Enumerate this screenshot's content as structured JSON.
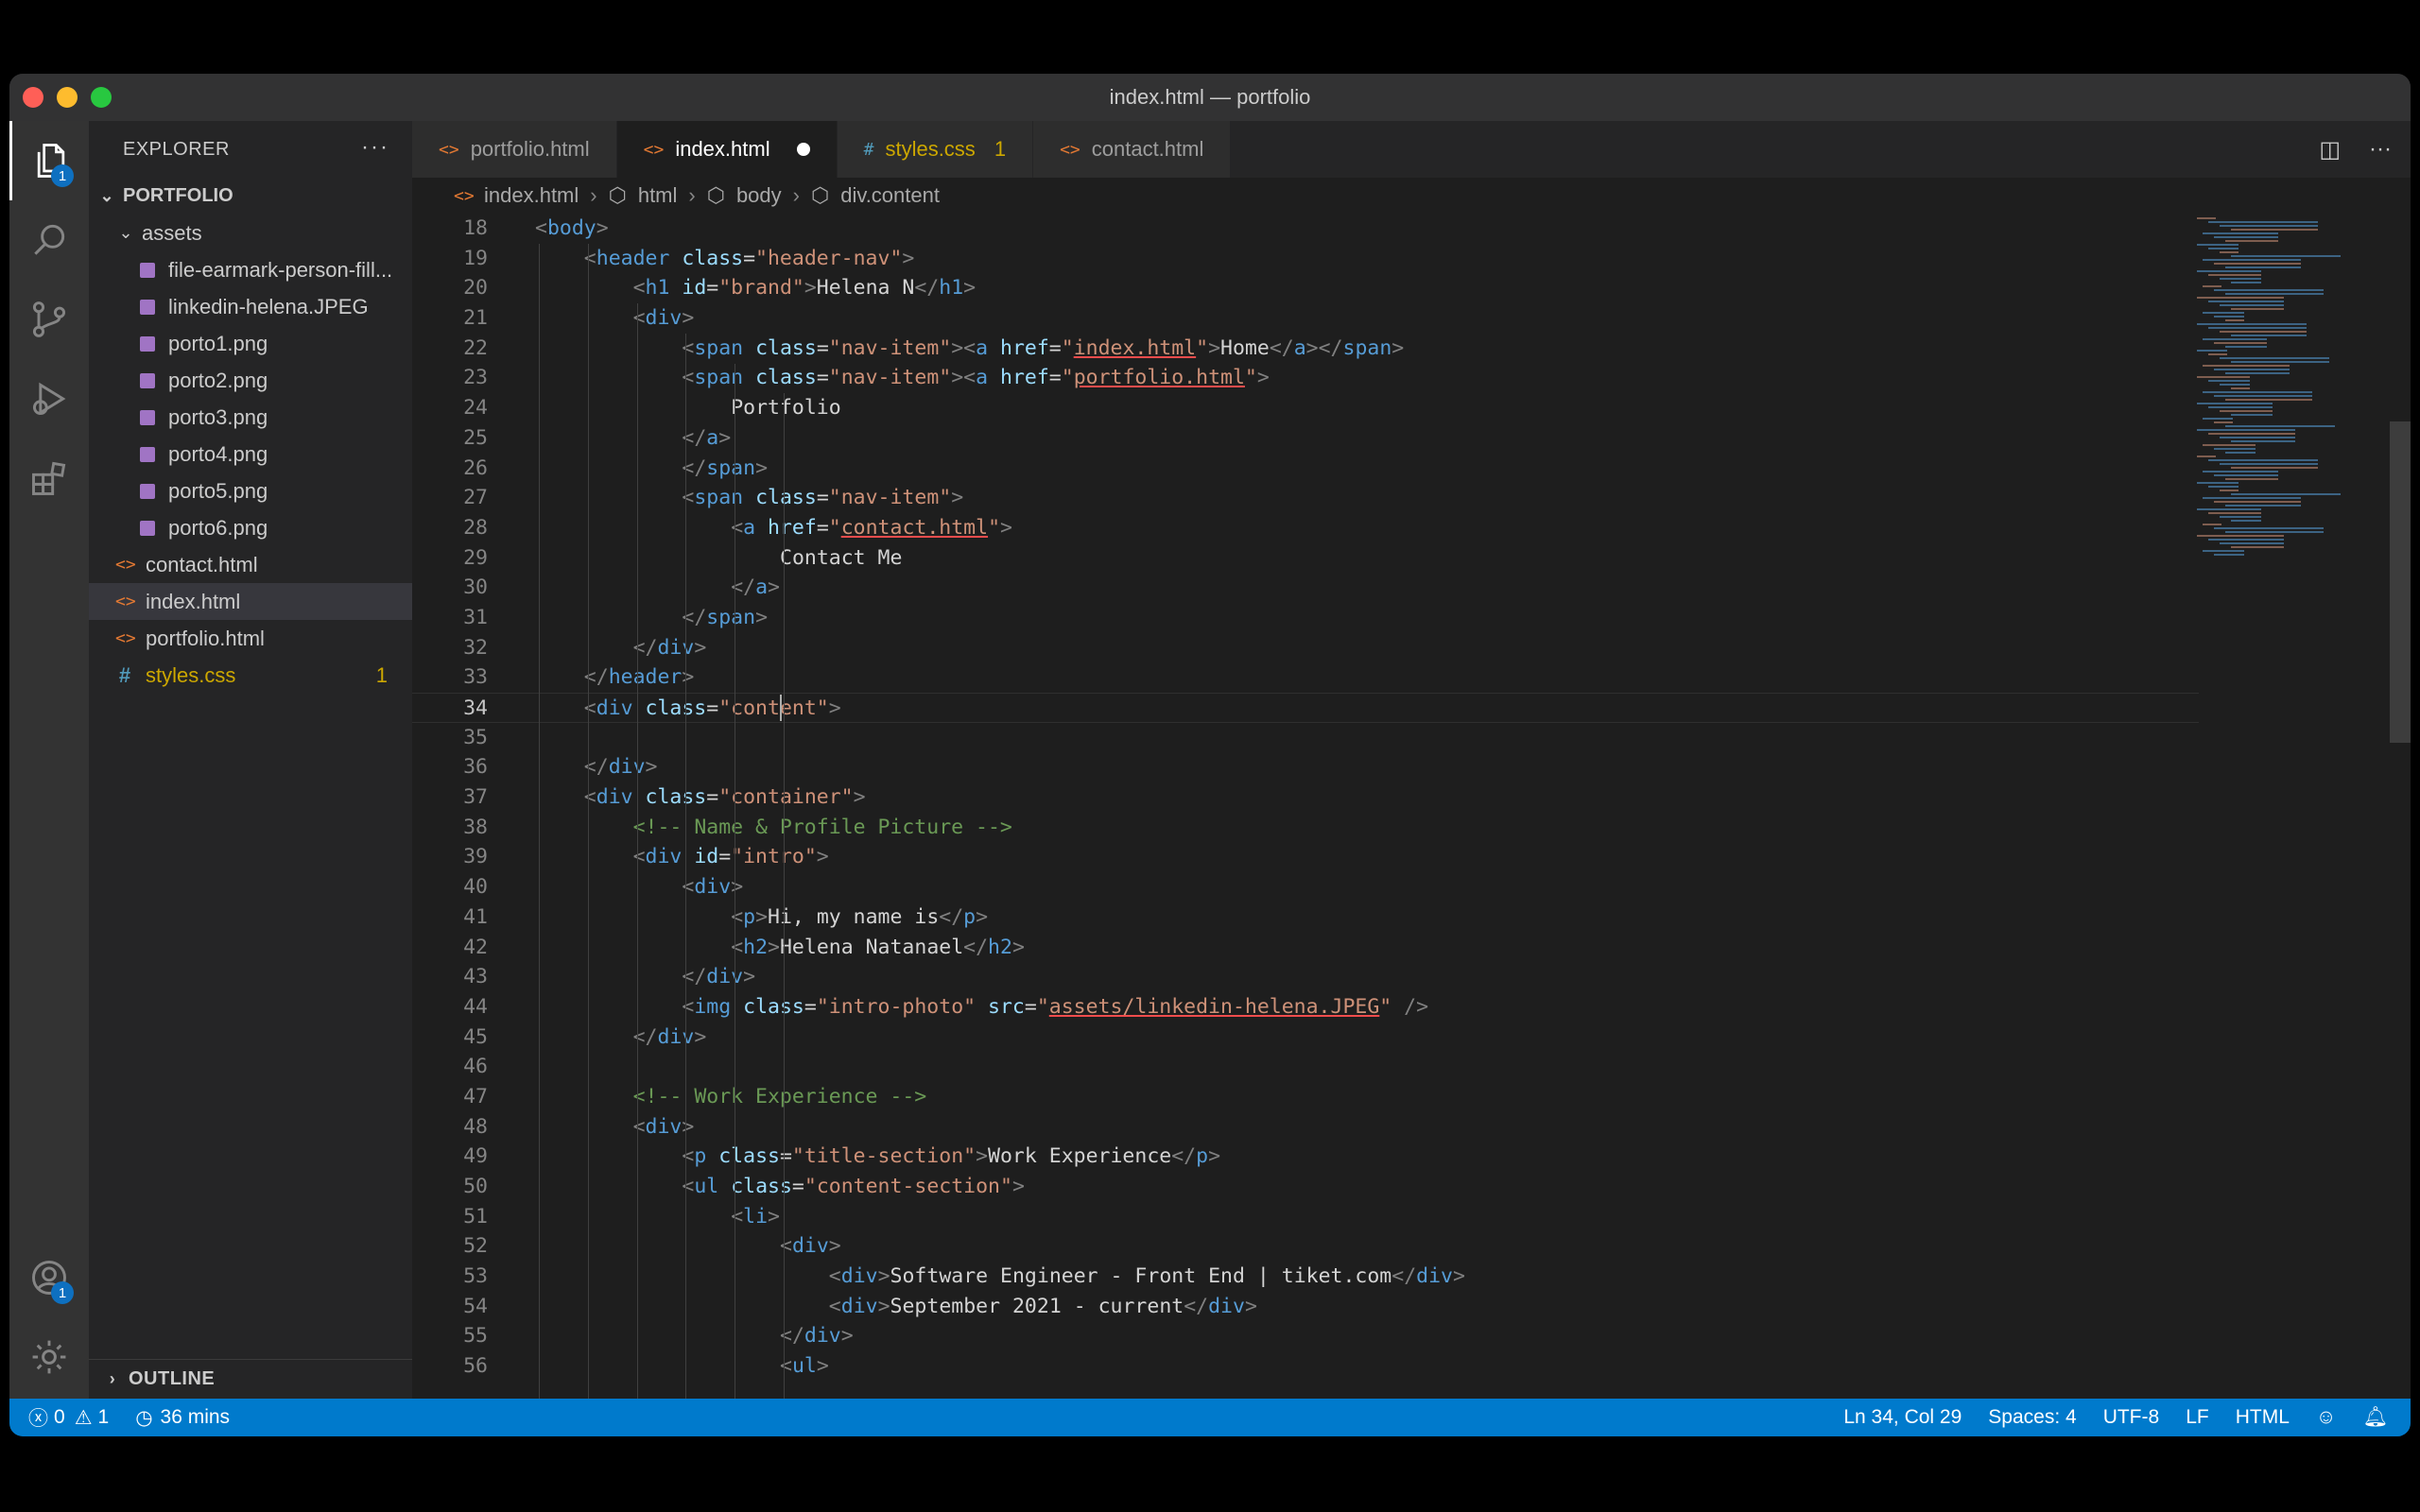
{
  "window": {
    "title": "index.html — portfolio"
  },
  "activity_bar": {
    "items": [
      {
        "name": "explorer",
        "icon": "files-icon",
        "badge": "1"
      },
      {
        "name": "search",
        "icon": "search-icon"
      },
      {
        "name": "source-control",
        "icon": "source-control-icon"
      },
      {
        "name": "run-debug",
        "icon": "run-debug-icon"
      },
      {
        "name": "extensions",
        "icon": "extensions-icon"
      }
    ],
    "accounts_badge": "1"
  },
  "sidebar": {
    "title": "EXPLORER",
    "more": "···",
    "folder": "PORTFOLIO",
    "items": [
      {
        "label": "assets",
        "type": "folder"
      },
      {
        "label": "file-earmark-person-fill...",
        "type": "file-svg"
      },
      {
        "label": "linkedin-helena.JPEG",
        "type": "image"
      },
      {
        "label": "porto1.png",
        "type": "image"
      },
      {
        "label": "porto2.png",
        "type": "image"
      },
      {
        "label": "porto3.png",
        "type": "image"
      },
      {
        "label": "porto4.png",
        "type": "image"
      },
      {
        "label": "porto5.png",
        "type": "image"
      },
      {
        "label": "porto6.png",
        "type": "image"
      },
      {
        "label": "contact.html",
        "type": "html"
      },
      {
        "label": "index.html",
        "type": "html",
        "selected": true
      },
      {
        "label": "portfolio.html",
        "type": "html"
      },
      {
        "label": "styles.css",
        "type": "css",
        "problems": "1"
      }
    ],
    "outline": "OUTLINE"
  },
  "tabs": [
    {
      "label": "portfolio.html",
      "type": "html"
    },
    {
      "label": "index.html",
      "type": "html",
      "active": true,
      "dirty": true
    },
    {
      "label": "styles.css",
      "type": "css",
      "problems": "1"
    },
    {
      "label": "contact.html",
      "type": "html"
    }
  ],
  "breadcrumb": [
    "index.html",
    "html",
    "body",
    "div.content"
  ],
  "editor": {
    "lines": [
      {
        "n": "18",
        "indent": 1,
        "t": [
          [
            "br",
            "<"
          ],
          [
            "tg",
            "body"
          ],
          [
            "br",
            ">"
          ]
        ]
      },
      {
        "n": "19",
        "indent": 2,
        "t": [
          [
            "br",
            "<"
          ],
          [
            "tg",
            "header "
          ],
          [
            "at",
            "class"
          ],
          [
            "p",
            "="
          ],
          [
            "st",
            "\"header-nav\""
          ],
          [
            "br",
            ">"
          ]
        ]
      },
      {
        "n": "20",
        "indent": 3,
        "t": [
          [
            "br",
            "<"
          ],
          [
            "tg",
            "h1 "
          ],
          [
            "at",
            "id"
          ],
          [
            "p",
            "="
          ],
          [
            "st",
            "\"brand\""
          ],
          [
            "br",
            ">"
          ],
          [
            "p",
            "Helena N"
          ],
          [
            "br",
            "</"
          ],
          [
            "tg",
            "h1"
          ],
          [
            "br",
            ">"
          ]
        ]
      },
      {
        "n": "21",
        "indent": 3,
        "t": [
          [
            "br",
            "<"
          ],
          [
            "tg",
            "div"
          ],
          [
            "br",
            ">"
          ]
        ]
      },
      {
        "n": "22",
        "indent": 4,
        "t": [
          [
            "br",
            "<"
          ],
          [
            "tg",
            "span "
          ],
          [
            "at",
            "class"
          ],
          [
            "p",
            "="
          ],
          [
            "st",
            "\"nav-item\""
          ],
          [
            "br",
            "><"
          ],
          [
            "tg",
            "a "
          ],
          [
            "at",
            "href"
          ],
          [
            "p",
            "="
          ],
          [
            "st",
            "\""
          ],
          [
            "stu",
            "index.html"
          ],
          [
            "st",
            "\""
          ],
          [
            "br",
            ">"
          ],
          [
            "p",
            "Home"
          ],
          [
            "br",
            "</"
          ],
          [
            "tg",
            "a"
          ],
          [
            "br",
            "></"
          ],
          [
            "tg",
            "span"
          ],
          [
            "br",
            ">"
          ]
        ]
      },
      {
        "n": "23",
        "indent": 4,
        "t": [
          [
            "br",
            "<"
          ],
          [
            "tg",
            "span "
          ],
          [
            "at",
            "class"
          ],
          [
            "p",
            "="
          ],
          [
            "st",
            "\"nav-item\""
          ],
          [
            "br",
            "><"
          ],
          [
            "tg",
            "a "
          ],
          [
            "at",
            "href"
          ],
          [
            "p",
            "="
          ],
          [
            "st",
            "\""
          ],
          [
            "stu",
            "portfolio.html"
          ],
          [
            "st",
            "\""
          ],
          [
            "br",
            ">"
          ]
        ]
      },
      {
        "n": "24",
        "indent": 5,
        "t": [
          [
            "p",
            "Portfolio"
          ]
        ]
      },
      {
        "n": "25",
        "indent": 4,
        "t": [
          [
            "br",
            "</"
          ],
          [
            "tg",
            "a"
          ],
          [
            "br",
            ">"
          ]
        ]
      },
      {
        "n": "26",
        "indent": 4,
        "t": [
          [
            "br",
            "</"
          ],
          [
            "tg",
            "span"
          ],
          [
            "br",
            ">"
          ]
        ]
      },
      {
        "n": "27",
        "indent": 4,
        "t": [
          [
            "br",
            "<"
          ],
          [
            "tg",
            "span "
          ],
          [
            "at",
            "class"
          ],
          [
            "p",
            "="
          ],
          [
            "st",
            "\"nav-item\""
          ],
          [
            "br",
            ">"
          ]
        ]
      },
      {
        "n": "28",
        "indent": 5,
        "t": [
          [
            "br",
            "<"
          ],
          [
            "tg",
            "a "
          ],
          [
            "at",
            "href"
          ],
          [
            "p",
            "="
          ],
          [
            "st",
            "\""
          ],
          [
            "stu",
            "contact.html"
          ],
          [
            "st",
            "\""
          ],
          [
            "br",
            ">"
          ]
        ]
      },
      {
        "n": "29",
        "indent": 6,
        "t": [
          [
            "p",
            "Contact Me"
          ]
        ]
      },
      {
        "n": "30",
        "indent": 5,
        "t": [
          [
            "br",
            "</"
          ],
          [
            "tg",
            "a"
          ],
          [
            "br",
            ">"
          ]
        ]
      },
      {
        "n": "31",
        "indent": 4,
        "t": [
          [
            "br",
            "</"
          ],
          [
            "tg",
            "span"
          ],
          [
            "br",
            ">"
          ]
        ]
      },
      {
        "n": "32",
        "indent": 3,
        "t": [
          [
            "br",
            "</"
          ],
          [
            "tg",
            "div"
          ],
          [
            "br",
            ">"
          ]
        ]
      },
      {
        "n": "33",
        "indent": 2,
        "t": [
          [
            "br",
            "</"
          ],
          [
            "tg",
            "header"
          ],
          [
            "br",
            ">"
          ]
        ]
      },
      {
        "n": "34",
        "indent": 2,
        "current": true,
        "t": [
          [
            "br",
            "<"
          ],
          [
            "tg",
            "div "
          ],
          [
            "at",
            "class"
          ],
          [
            "p",
            "="
          ],
          [
            "st",
            "\"content\""
          ],
          [
            "br",
            ">"
          ]
        ]
      },
      {
        "n": "35",
        "indent": 0,
        "t": []
      },
      {
        "n": "36",
        "indent": 2,
        "t": [
          [
            "br",
            "</"
          ],
          [
            "tg",
            "div"
          ],
          [
            "br",
            ">"
          ]
        ]
      },
      {
        "n": "37",
        "indent": 2,
        "t": [
          [
            "br",
            "<"
          ],
          [
            "tg",
            "div "
          ],
          [
            "at",
            "class"
          ],
          [
            "p",
            "="
          ],
          [
            "st",
            "\"container\""
          ],
          [
            "br",
            ">"
          ]
        ]
      },
      {
        "n": "38",
        "indent": 3,
        "t": [
          [
            "cm",
            "<!-- Name & Profile Picture -->"
          ]
        ]
      },
      {
        "n": "39",
        "indent": 3,
        "t": [
          [
            "br",
            "<"
          ],
          [
            "tg",
            "div "
          ],
          [
            "at",
            "id"
          ],
          [
            "p",
            "="
          ],
          [
            "st",
            "\"intro\""
          ],
          [
            "br",
            ">"
          ]
        ]
      },
      {
        "n": "40",
        "indent": 4,
        "t": [
          [
            "br",
            "<"
          ],
          [
            "tg",
            "div"
          ],
          [
            "br",
            ">"
          ]
        ]
      },
      {
        "n": "41",
        "indent": 5,
        "t": [
          [
            "br",
            "<"
          ],
          [
            "tg",
            "p"
          ],
          [
            "br",
            ">"
          ],
          [
            "p",
            "Hi, my name is"
          ],
          [
            "br",
            "</"
          ],
          [
            "tg",
            "p"
          ],
          [
            "br",
            ">"
          ]
        ]
      },
      {
        "n": "42",
        "indent": 5,
        "t": [
          [
            "br",
            "<"
          ],
          [
            "tg",
            "h2"
          ],
          [
            "br",
            ">"
          ],
          [
            "p",
            "Helena Natanael"
          ],
          [
            "br",
            "</"
          ],
          [
            "tg",
            "h2"
          ],
          [
            "br",
            ">"
          ]
        ]
      },
      {
        "n": "43",
        "indent": 4,
        "t": [
          [
            "br",
            "</"
          ],
          [
            "tg",
            "div"
          ],
          [
            "br",
            ">"
          ]
        ]
      },
      {
        "n": "44",
        "indent": 4,
        "t": [
          [
            "br",
            "<"
          ],
          [
            "tg",
            "img "
          ],
          [
            "at",
            "class"
          ],
          [
            "p",
            "="
          ],
          [
            "st",
            "\"intro-photo\" "
          ],
          [
            "at",
            "src"
          ],
          [
            "p",
            "="
          ],
          [
            "st",
            "\""
          ],
          [
            "stu",
            "assets/linkedin-helena.JPEG"
          ],
          [
            "st",
            "\" "
          ],
          [
            "br",
            "/>"
          ]
        ]
      },
      {
        "n": "45",
        "indent": 3,
        "t": [
          [
            "br",
            "</"
          ],
          [
            "tg",
            "div"
          ],
          [
            "br",
            ">"
          ]
        ]
      },
      {
        "n": "46",
        "indent": 0,
        "t": []
      },
      {
        "n": "47",
        "indent": 3,
        "t": [
          [
            "cm",
            "<!-- Work Experience -->"
          ]
        ]
      },
      {
        "n": "48",
        "indent": 3,
        "t": [
          [
            "br",
            "<"
          ],
          [
            "tg",
            "div"
          ],
          [
            "br",
            ">"
          ]
        ]
      },
      {
        "n": "49",
        "indent": 4,
        "t": [
          [
            "br",
            "<"
          ],
          [
            "tg",
            "p "
          ],
          [
            "at",
            "class"
          ],
          [
            "p",
            "="
          ],
          [
            "st",
            "\"title-section\""
          ],
          [
            "br",
            ">"
          ],
          [
            "p",
            "Work Experience"
          ],
          [
            "br",
            "</"
          ],
          [
            "tg",
            "p"
          ],
          [
            "br",
            ">"
          ]
        ]
      },
      {
        "n": "50",
        "indent": 4,
        "t": [
          [
            "br",
            "<"
          ],
          [
            "tg",
            "ul "
          ],
          [
            "at",
            "class"
          ],
          [
            "p",
            "="
          ],
          [
            "st",
            "\"content-section\""
          ],
          [
            "br",
            ">"
          ]
        ]
      },
      {
        "n": "51",
        "indent": 5,
        "t": [
          [
            "br",
            "<"
          ],
          [
            "tg",
            "li"
          ],
          [
            "br",
            ">"
          ]
        ]
      },
      {
        "n": "52",
        "indent": 6,
        "t": [
          [
            "br",
            "<"
          ],
          [
            "tg",
            "div"
          ],
          [
            "br",
            ">"
          ]
        ]
      },
      {
        "n": "53",
        "indent": 7,
        "t": [
          [
            "br",
            "<"
          ],
          [
            "tg",
            "div"
          ],
          [
            "br",
            ">"
          ],
          [
            "p",
            "Software Engineer - Front End | tiket.com"
          ],
          [
            "br",
            "</"
          ],
          [
            "tg",
            "div"
          ],
          [
            "br",
            ">"
          ]
        ]
      },
      {
        "n": "54",
        "indent": 7,
        "t": [
          [
            "br",
            "<"
          ],
          [
            "tg",
            "div"
          ],
          [
            "br",
            ">"
          ],
          [
            "p",
            "September 2021 - current"
          ],
          [
            "br",
            "</"
          ],
          [
            "tg",
            "div"
          ],
          [
            "br",
            ">"
          ]
        ]
      },
      {
        "n": "55",
        "indent": 6,
        "t": [
          [
            "br",
            "</"
          ],
          [
            "tg",
            "div"
          ],
          [
            "br",
            ">"
          ]
        ]
      },
      {
        "n": "56",
        "indent": 6,
        "t": [
          [
            "br",
            "<"
          ],
          [
            "tg",
            "ul"
          ],
          [
            "br",
            ">"
          ]
        ]
      }
    ]
  },
  "status_bar": {
    "errors": "0",
    "warnings": "1",
    "time": "36 mins",
    "position": "Ln 34, Col 29",
    "spaces": "Spaces: 4",
    "encoding": "UTF-8",
    "eol": "LF",
    "language": "HTML"
  },
  "colors": {
    "accent": "#007acc",
    "html_icon": "#e37933",
    "css_icon": "#519aba",
    "warning": "#cca700"
  }
}
